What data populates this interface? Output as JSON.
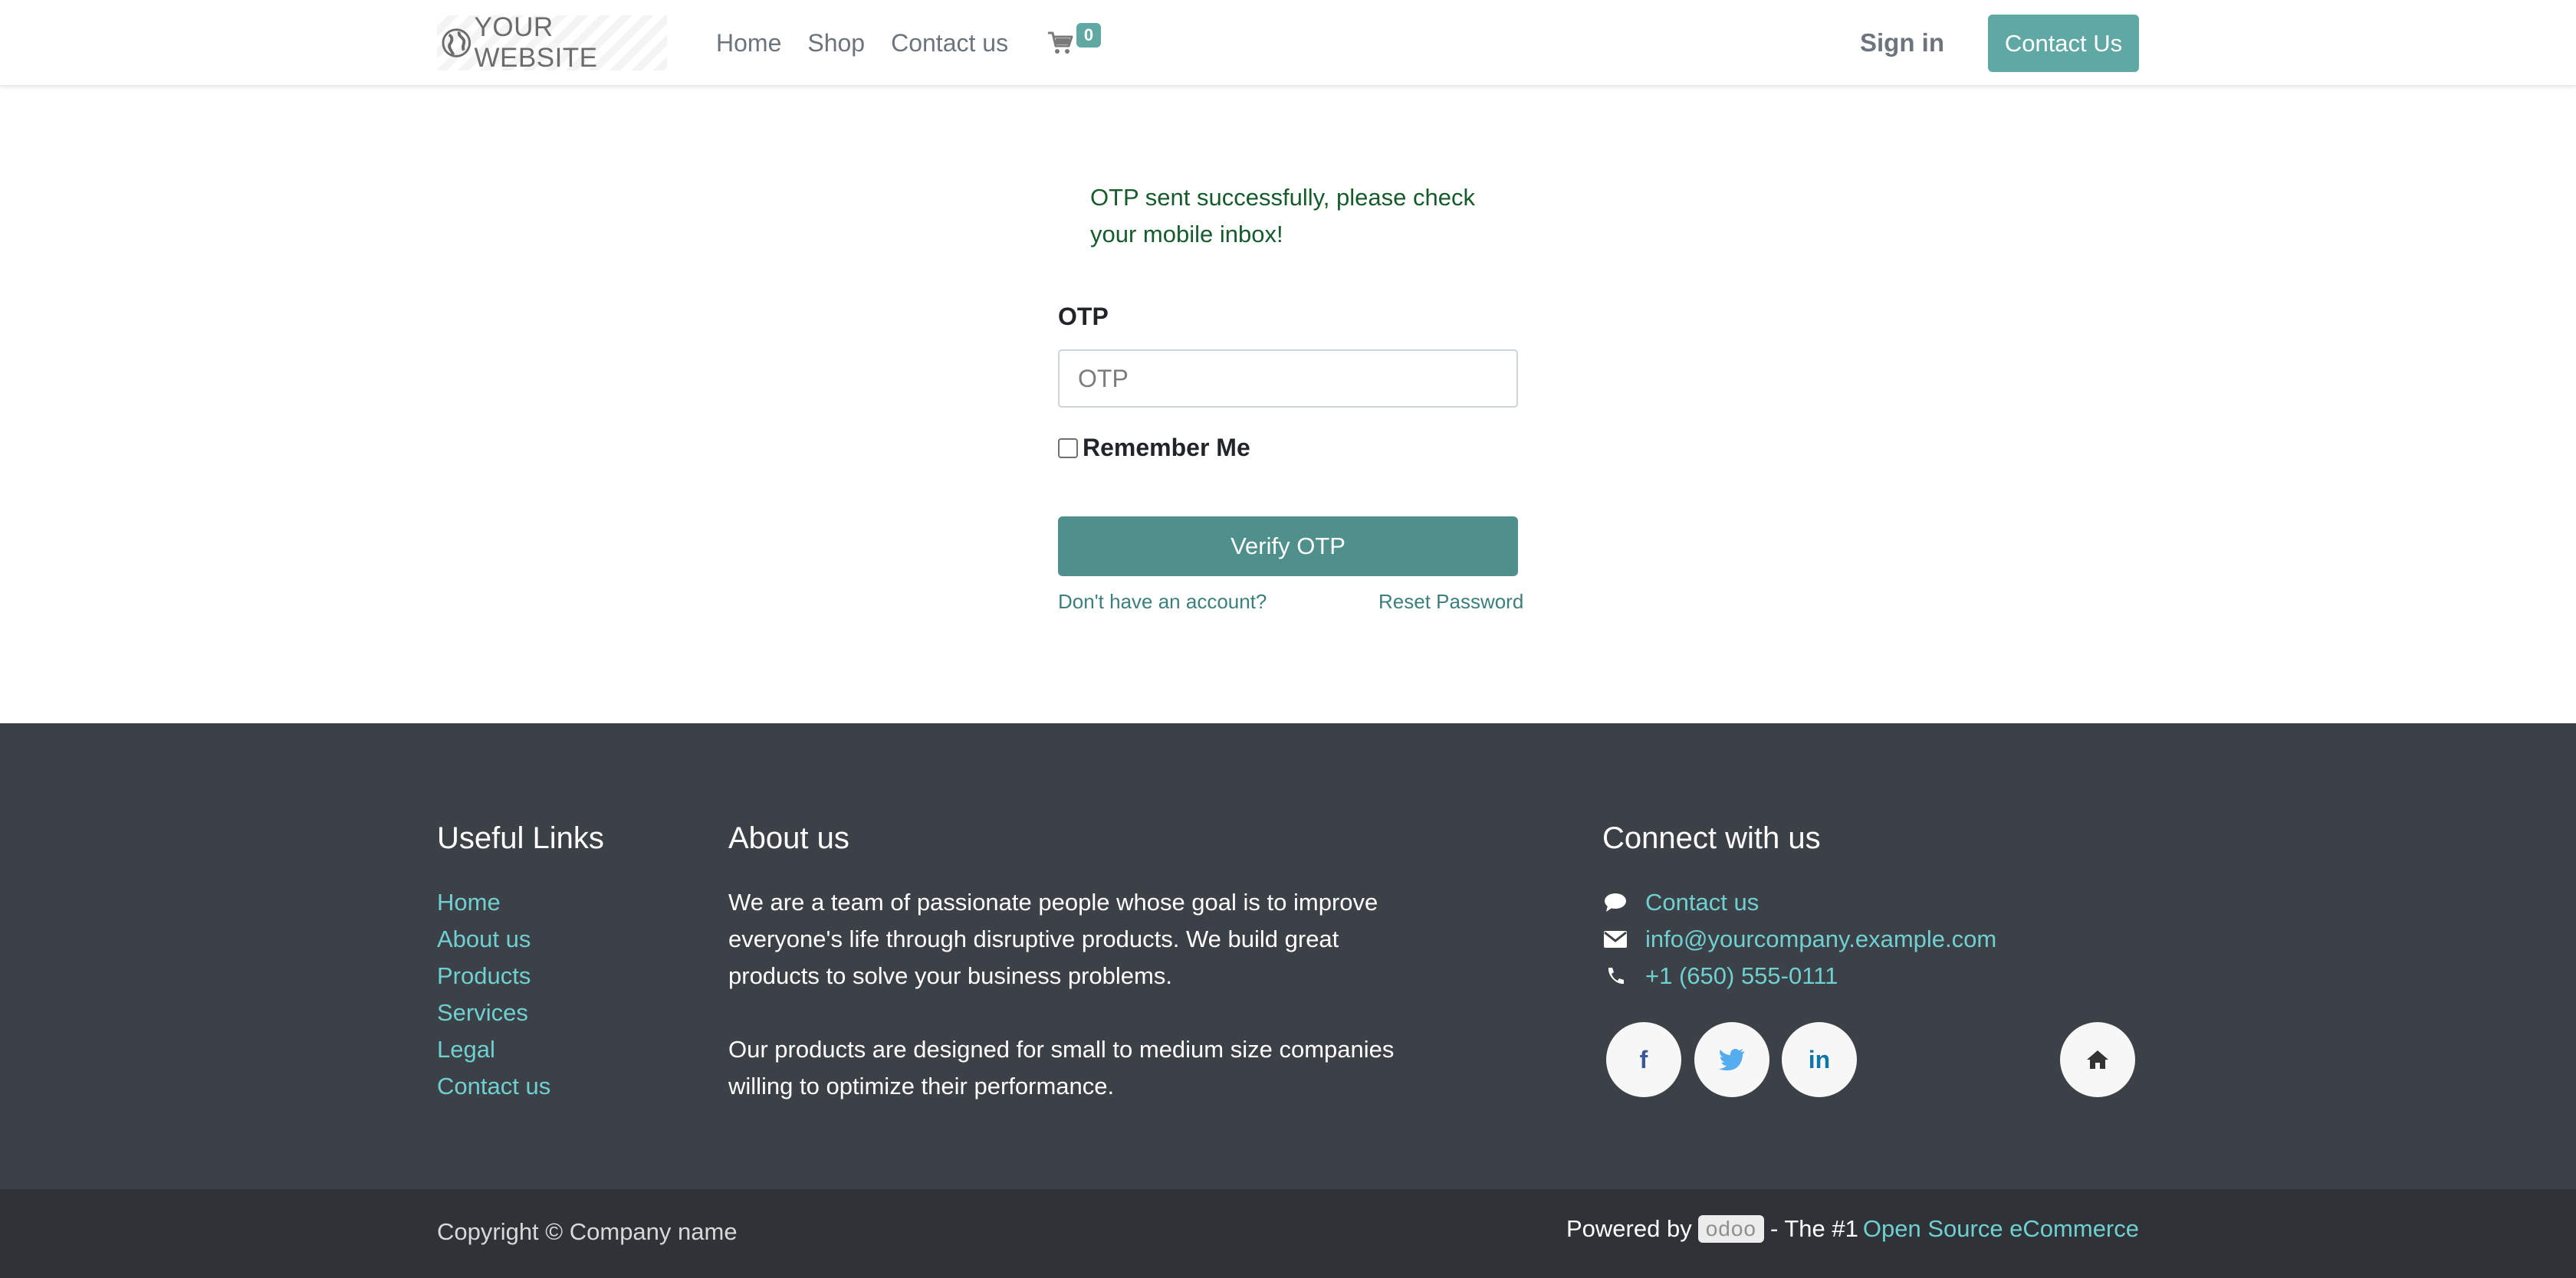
{
  "header": {
    "brand": "YOUR WEBSITE",
    "nav": [
      "Home",
      "Shop",
      "Contact us"
    ],
    "cart_count": "0",
    "sign_in": "Sign in",
    "contact_button": "Contact Us"
  },
  "form": {
    "alert": "OTP sent successfully, please check your mobile inbox!",
    "otp_label": "OTP",
    "otp_placeholder": "OTP",
    "otp_value": "",
    "remember_label": "Remember Me",
    "remember_checked": false,
    "verify_button": "Verify OTP",
    "no_account_link": "Don't have an account?",
    "reset_password_link": "Reset Password"
  },
  "footer": {
    "useful_links_title": "Useful Links",
    "useful_links": [
      "Home",
      "About us",
      "Products",
      "Services",
      "Legal",
      "Contact us"
    ],
    "about_title": "About us",
    "about_paragraphs": [
      "We are a team of passionate people whose goal is to improve everyone's life through disruptive products. We build great products to solve your business problems.",
      "Our products are designed for small to medium size companies willing to optimize their performance."
    ],
    "connect_title": "Connect with us",
    "connect_items": [
      {
        "icon": "comment-icon",
        "text": "Contact us"
      },
      {
        "icon": "envelope-icon",
        "text": "info@yourcompany.example.com"
      },
      {
        "icon": "phone-icon",
        "text": "+1 (650) 555-0111"
      }
    ],
    "social": {
      "facebook": "f",
      "twitter": "bird",
      "linkedin": "in",
      "home": "home"
    },
    "copyright": "Copyright © Company name",
    "powered_by": "Powered by",
    "odoo": "odoo",
    "the_number_one": "- The #1",
    "open_source_link": "Open Source eCommerce"
  },
  "colors": {
    "primary": "#5fa8a4",
    "primary_dark": "#4f8f8c",
    "footer_bg": "#3c4047",
    "footer_link": "#6fd0d2"
  }
}
